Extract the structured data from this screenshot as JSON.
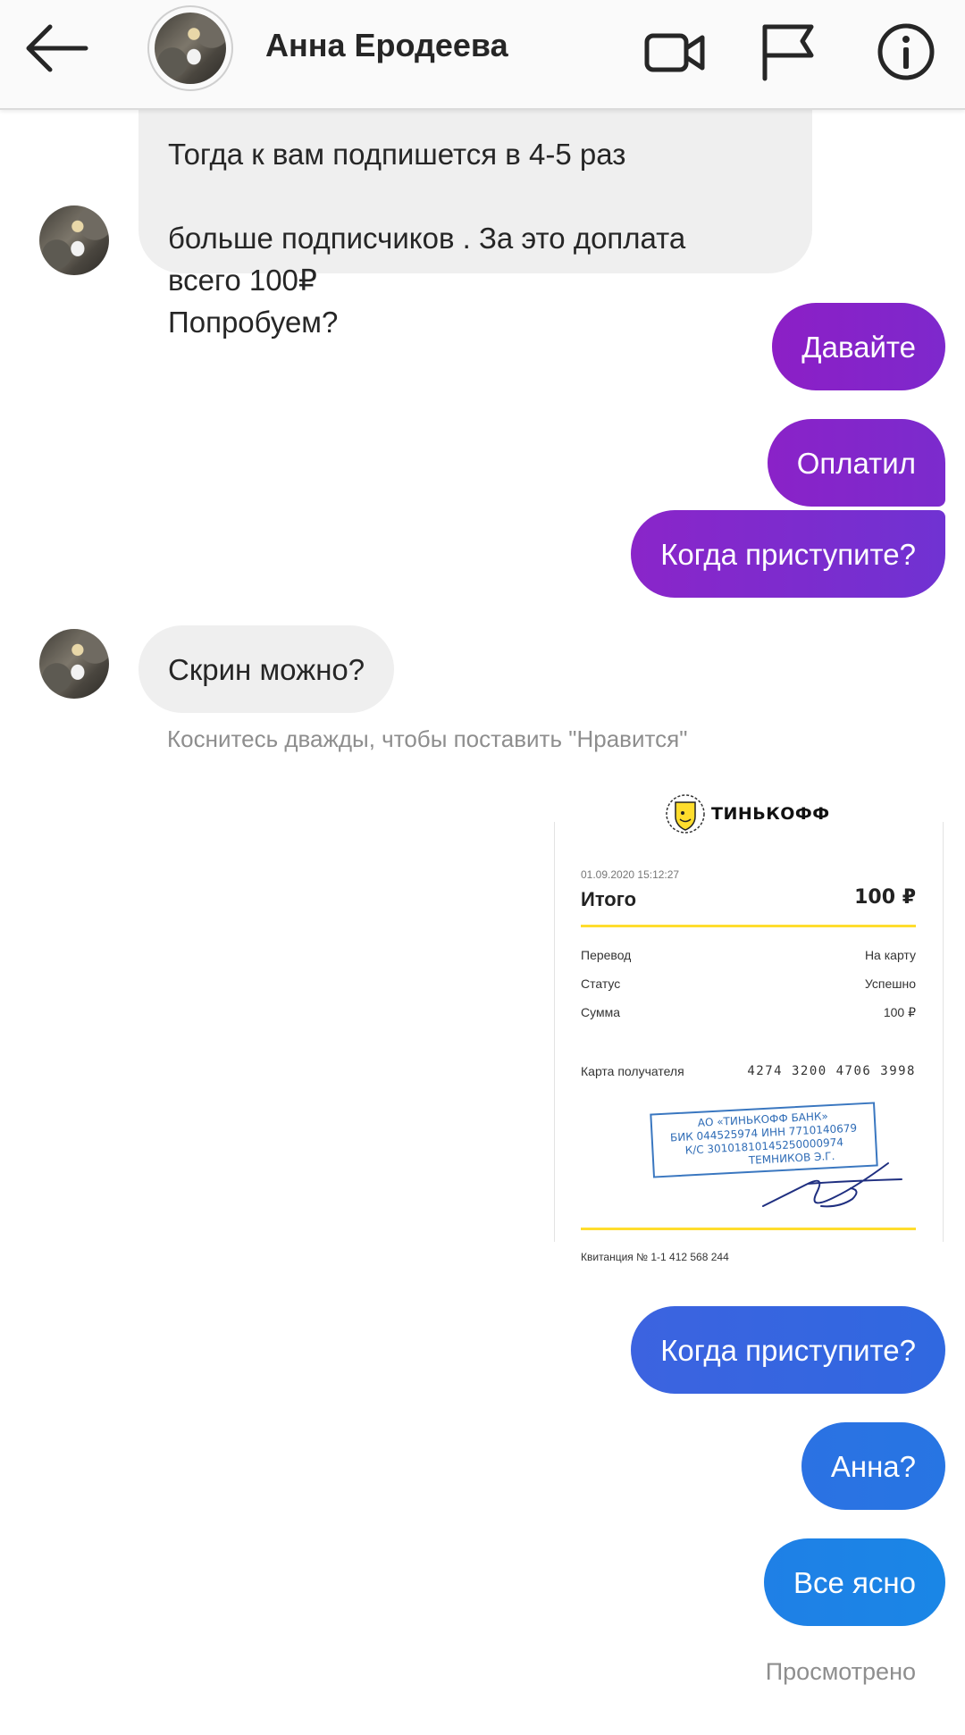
{
  "header": {
    "contact_name": "Анна Еродеева",
    "back_icon": "back-arrow-icon",
    "video_icon": "video-camera-icon",
    "flag_icon": "flag-icon",
    "info_icon": "info-icon"
  },
  "messages": {
    "incoming_1": {
      "partial_line": "Тогда к вам подпишется в 4-5 раз",
      "text": "больше подписчиков . За это доплата\nвсего 100₽\nПопробуем?"
    },
    "outgoing_1": "Давайте",
    "outgoing_2": "Оплатил",
    "outgoing_3": "Когда приступите?",
    "incoming_2": "Скрин можно?",
    "like_hint": "Коснитесь дважды, чтобы поставить \"Нравится\"",
    "outgoing_4": "Когда приступите?",
    "outgoing_5": "Анна?",
    "outgoing_6": "Все ясно",
    "seen_status": "Просмотрено"
  },
  "receipt": {
    "brand": "ТИНЬКОФФ",
    "datetime": "01.09.2020  15:12:27",
    "total_label": "Итого",
    "total_value": "100 ₽",
    "rows": [
      {
        "label": "Перевод",
        "value": "На карту"
      },
      {
        "label": "Статус",
        "value": "Успешно"
      },
      {
        "label": "Сумма",
        "value": "100 ₽"
      }
    ],
    "card_label": "Карта получателя",
    "card_number": "4274 3200 4706 3998",
    "stamp_lines": [
      "АО «ТИНЬКОФФ БАНК»",
      "БИК 044525974   ИНН 7710140679",
      "К/С 30101810145250000974",
      "ТЕМНИКОВ Э.Г."
    ],
    "receipt_number": "Квитанция  № 1-1 412 568 244"
  },
  "colors": {
    "header_bg": "#fafafa",
    "incoming_bubble": "#efefef",
    "outgoing_purple_start": "#8c1fc6",
    "outgoing_purple_end": "#7c2fd0",
    "outgoing_blue_start": "#3465e0",
    "outgoing_blue_end": "#1a86e6",
    "meta_text": "#8e8e8e",
    "tinkoff_yellow": "#ffdd2d",
    "stamp_blue": "#2f6cb6"
  }
}
